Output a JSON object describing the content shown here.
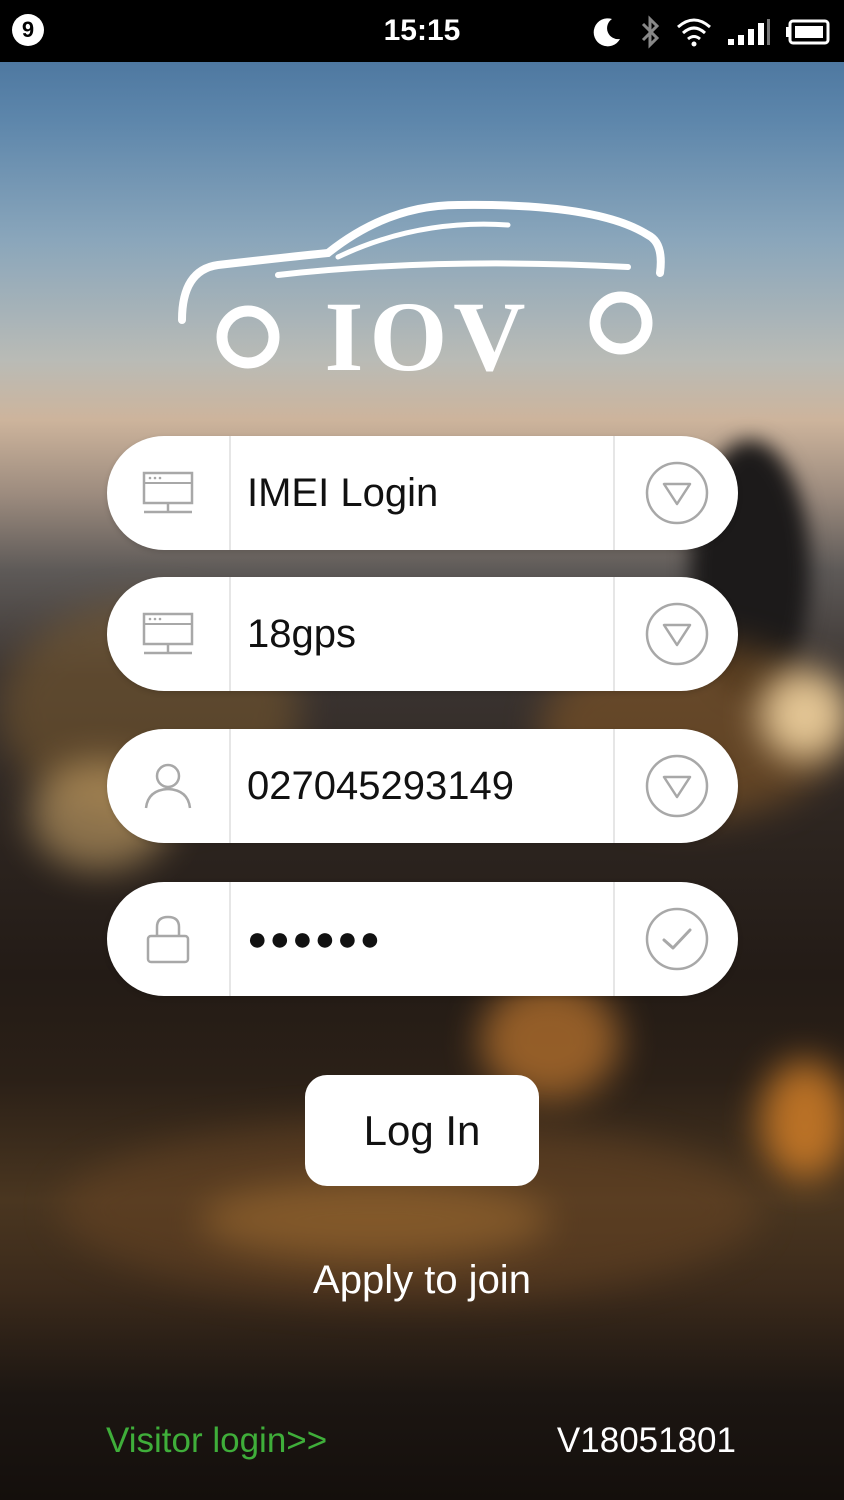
{
  "status_bar": {
    "notification_count": "9",
    "time": "15:15",
    "icons": [
      "moon-icon",
      "bluetooth-icon",
      "wifi-icon",
      "signal-icon",
      "battery-icon"
    ]
  },
  "logo": {
    "text": "IOV"
  },
  "form": {
    "login_type": {
      "value": "IMEI Login",
      "left_icon": "server-icon",
      "right_icon": "dropdown-icon"
    },
    "server": {
      "value": "18gps",
      "left_icon": "server-icon",
      "right_icon": "dropdown-icon"
    },
    "account": {
      "value": "027045293149",
      "left_icon": "user-icon",
      "right_icon": "dropdown-icon"
    },
    "password": {
      "value": "●●●●●●",
      "left_icon": "lock-icon",
      "right_icon": "check-icon"
    }
  },
  "login_button": {
    "label": "Log In"
  },
  "apply_link": {
    "label": "Apply to join"
  },
  "visitor_link": {
    "label": "Visitor login>>"
  },
  "version": "V18051801",
  "colors": {
    "visitor_link": "#3fae3a",
    "field_bg": "#ffffff",
    "icon_gray": "#a8a8a8"
  }
}
